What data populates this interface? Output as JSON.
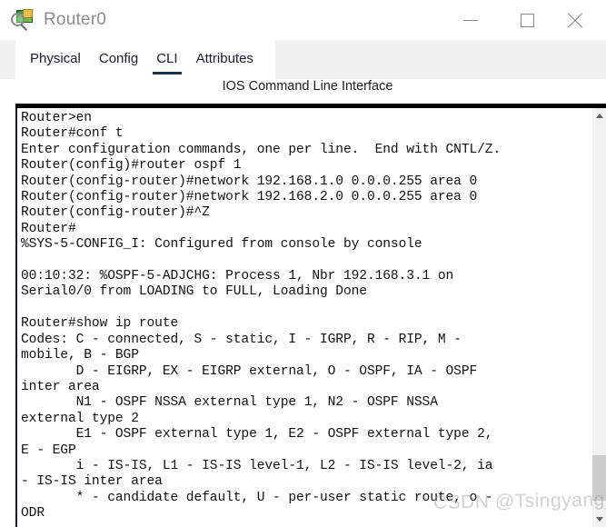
{
  "window": {
    "title": "Router0",
    "icon": "router-magnifier-icon",
    "controls": {
      "minimize_label": "Minimize",
      "maximize_label": "Maximize",
      "close_label": "Close"
    }
  },
  "tabs": [
    {
      "label": "Physical",
      "active": false,
      "name": "tab-physical"
    },
    {
      "label": "Config",
      "active": false,
      "name": "tab-config"
    },
    {
      "label": "CLI",
      "active": true,
      "name": "tab-cli"
    },
    {
      "label": "Attributes",
      "active": false,
      "name": "tab-attributes"
    }
  ],
  "panel": {
    "header": "IOS Command Line Interface"
  },
  "terminal": {
    "content": "Router>en\nRouter#conf t\nEnter configuration commands, one per line.  End with CNTL/Z.\nRouter(config)#router ospf 1\nRouter(config-router)#network 192.168.1.0 0.0.0.255 area 0\nRouter(config-router)#network 192.168.2.0 0.0.0.255 area 0\nRouter(config-router)#^Z\nRouter#\n%SYS-5-CONFIG_I: Configured from console by console\n\n00:10:32: %OSPF-5-ADJCHG: Process 1, Nbr 192.168.3.1 on\nSerial0/0 from LOADING to FULL, Loading Done\n\nRouter#show ip route\nCodes: C - connected, S - static, I - IGRP, R - RIP, M -\nmobile, B - BGP\n       D - EIGRP, EX - EIGRP external, O - OSPF, IA - OSPF\ninter area\n       N1 - OSPF NSSA external type 1, N2 - OSPF NSSA\nexternal type 2\n       E1 - OSPF external type 1, E2 - OSPF external type 2,\nE - EGP\n       i - IS-IS, L1 - IS-IS level-1, L2 - IS-IS level-2, ia\n- IS-IS inter area\n       * - candidate default, U - per-user static route, o -\nODR",
    "scrollbar": {
      "up_arrow": "chevron-up-icon",
      "down_arrow": "chevron-down-icon"
    }
  },
  "watermark": {
    "text": "CSDN @Tsingyang_"
  },
  "colors": {
    "accent": "#16304f",
    "tab_bg": "#f0f0f0",
    "terminal_border": "#000000",
    "title_text": "#8c8c8c"
  }
}
